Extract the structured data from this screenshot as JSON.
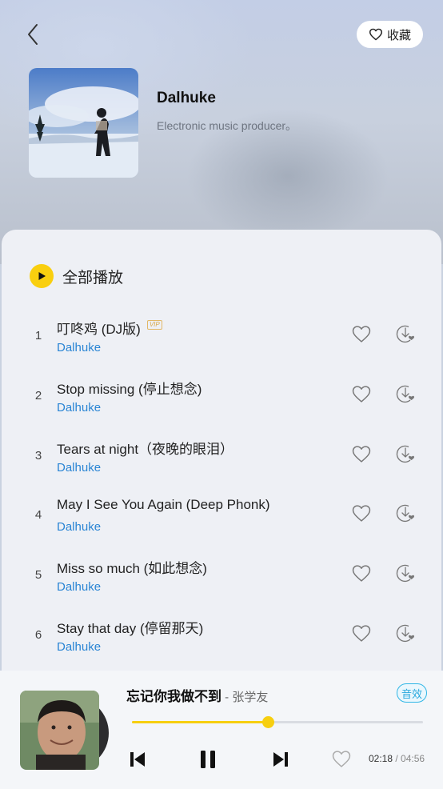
{
  "header": {
    "favorite_label": "收藏",
    "artist_name": "Dalhuke",
    "artist_desc": "Electronic music producer。"
  },
  "playlist": {
    "play_all_label": "全部播放",
    "songs": [
      {
        "index": "1",
        "title": "叮咚鸡 (DJ版)",
        "vip": "VIP",
        "artist": "Dalhuke"
      },
      {
        "index": "2",
        "title": "Stop missing (停止想念)",
        "artist": "Dalhuke"
      },
      {
        "index": "3",
        "title": "Tears at night（夜晚的眼泪）",
        "artist": "Dalhuke"
      },
      {
        "index": "4",
        "title": "May I See You Again (Deep Phonk)",
        "artist": "Dalhuke"
      },
      {
        "index": "5",
        "title": "Miss so much (如此想念)",
        "artist": "Dalhuke"
      },
      {
        "index": "6",
        "title": "Stay that day (停留那天)",
        "artist": "Dalhuke"
      }
    ]
  },
  "player": {
    "title": "忘记你我做不到",
    "artist": " - 张学友",
    "sound_effect_label": "音效",
    "current_time": "02:18",
    "separator": " / ",
    "total_time": "04:56",
    "progress": 0.466
  },
  "colors": {
    "accent_yellow": "#f9cf0f",
    "artist_link_blue": "#2a85d4",
    "sound_fx_blue": "#2aa9de"
  }
}
